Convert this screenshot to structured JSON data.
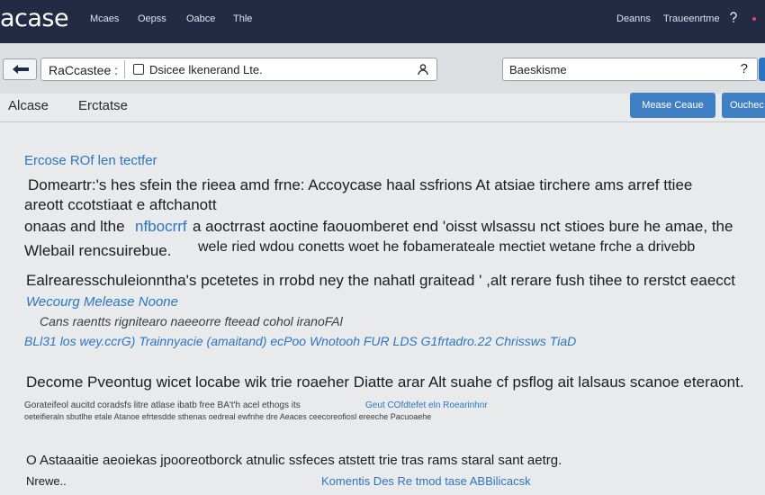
{
  "topbar": {
    "logo": "acase",
    "nav": [
      "Mcaes",
      "Oepss",
      "Oabce",
      "Thle"
    ],
    "right_nav": [
      "Deanns",
      "Traueenrtme"
    ],
    "help_icon": "question-icon"
  },
  "toolbar": {
    "back_icon": "arrow-left-icon",
    "address_left": "RaCcastee :",
    "address_value": "Dsicee lkenerand Lte.",
    "address_icon": "user-group-icon",
    "search_value": "Baeskisme",
    "search_help": "?"
  },
  "tabs": {
    "items": [
      "Alcase",
      "Erctatse"
    ],
    "primary_button": "Mease Ceaue",
    "secondary_button": "Ouchec"
  },
  "content": {
    "link_heading": "Ercose ROf len tectfer",
    "p1_line1": "Domeartr:'s hes sfein the rieea amd frne: Accoycase haal ssfrions  At atsiae tirchere ams arref ttiee",
    "p1_line2": "areott ccotstiaat e aftchanott",
    "p1_line3a": "onaas and lthe",
    "p1_line3_link": "nfbocrrf",
    "p1_line3b": "a aoctrrast aoctine faouomberet  end 'oisst  wlsassu nct stioes bure he amae, the",
    "p1_line4a": "Wlebail rencsuirebue.",
    "p1_line4b": "wele ried wdou conetts woet he fobamerateale mectiet wetane frche  a drivebb",
    "p2_line1": "Ealrearesschuleionntha's pcetetes  in rrobd ney  the nahatl graitead ' ,alt rerare fush tihee to rerstct eaecct",
    "p2_link": "Wecourg Melease Noone",
    "p2_sub": "Cans raentts rignitearo naeeorre fteead cohol iranoFAl",
    "p2_blue_line": "BLl31 los wey.ccrG) Trainnyacie (amaitand) ecPoo  Wnotooh  FUR LDS G1frtadro.22 Chrissws TiaD",
    "p3_line1": "Decome Pveontug wicet locabe wik trie roaeher Diatte arar Alt suahe cf psflog ait lalsaus scanoe eteraont.",
    "p3_small1a": "Gorateifeol aucitd coradsfs litre atlase ibatb free BA't'h acel ethogs its",
    "p3_small1_link": "Geut  COfdtefet eln  Roearinhnr",
    "p3_small2": "oeteifieraln sbutlhe etale Atanoe efrtesdde sthenas oedreal ewfnhe dre Aeaces ceecoreofiosl ereeche Pacuoaehe",
    "p4_line1": "O Astaaaitie aeoiekas jpooreotborck atnulic ssfeces atstett trie tras rams staral sant aetrg.",
    "footer_left": "Nrewe..",
    "footer_link": "Komentis Des Re tmod tase ABBilicacsk"
  },
  "colors": {
    "topbar": "#222b43",
    "accent": "#3f7fc4",
    "link": "#2c75c0",
    "page_bg": "#e9eaec"
  }
}
